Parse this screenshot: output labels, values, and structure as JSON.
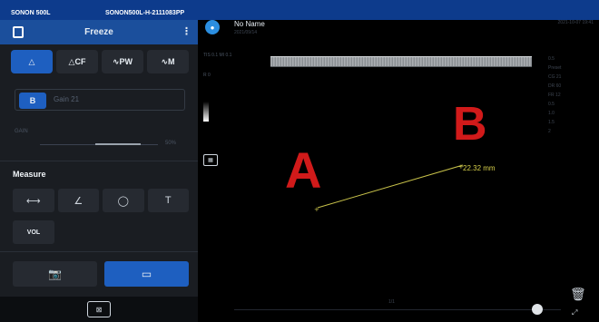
{
  "device": {
    "model": "SONON 500L",
    "serial": "SONON500L-H-2111083PP"
  },
  "header": {
    "title": "Freeze"
  },
  "modes": [
    {
      "label": "△",
      "icon": "b-mode-icon",
      "active": true
    },
    {
      "label": "△CF",
      "icon": "color-flow-icon",
      "active": false
    },
    {
      "label": "∿PW",
      "icon": "pulsed-wave-icon",
      "active": false
    },
    {
      "label": "∿M",
      "icon": "m-mode-icon",
      "active": false
    }
  ],
  "b_row": {
    "button": "B",
    "value": "Gain  21"
  },
  "gain": {
    "label": "GAIN",
    "value": "50%"
  },
  "measure": {
    "title": "Measure",
    "tools": [
      "⟷",
      "∠",
      "◯",
      "T"
    ],
    "vol": "VOL"
  },
  "patient": {
    "name": "No Name",
    "date": "2021/09/14"
  },
  "right_info": "2021-10-07 19:41",
  "small_info": "TIS 0.1  MI 0.1",
  "small_info2": "R 0",
  "right_scale": [
    "0.5",
    "Preset",
    "CG 21",
    "DR 60",
    "FR 12",
    "0.5",
    "1.0",
    "1.5",
    "2"
  ],
  "labels": {
    "A": "A",
    "B": "B"
  },
  "measurement": {
    "value": "22.32 mm"
  },
  "slider": {
    "label": "1/1"
  },
  "colors": {
    "accent": "#1e5fc0",
    "top_bar": "#0d3b8c",
    "label_red": "#d11a1a",
    "measure_yellow": "#d7d04a"
  }
}
